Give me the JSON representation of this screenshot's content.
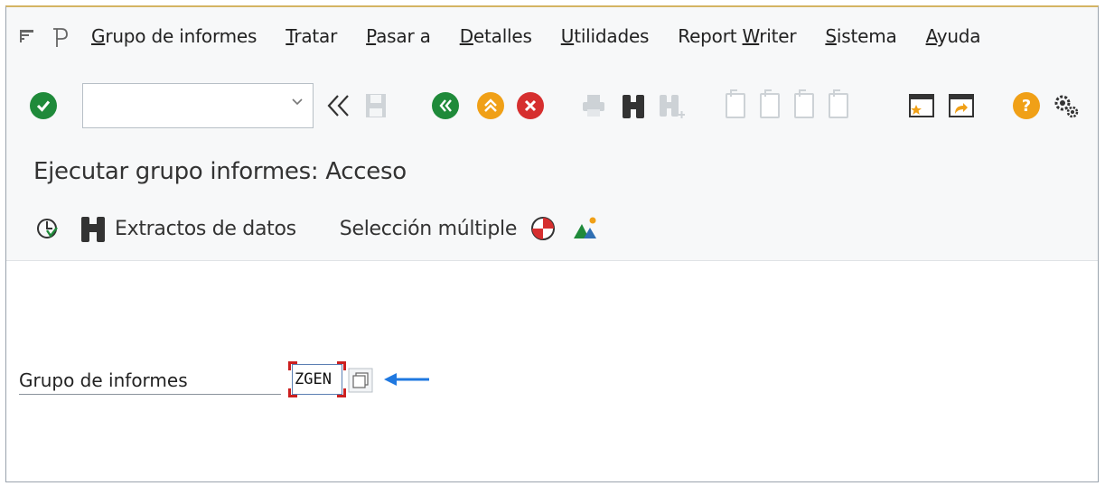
{
  "menu": {
    "items": [
      {
        "pre": "",
        "acc": "G",
        "post": "rupo de informes"
      },
      {
        "pre": "",
        "acc": "T",
        "post": "ratar"
      },
      {
        "pre": "",
        "acc": "P",
        "post": "asar a"
      },
      {
        "pre": "",
        "acc": "D",
        "post": "etalles"
      },
      {
        "pre": "",
        "acc": "U",
        "post": "tilidades"
      },
      {
        "pre": "Report ",
        "acc": "W",
        "post": "riter"
      },
      {
        "pre": "",
        "acc": "S",
        "post": "istema"
      },
      {
        "pre": "",
        "acc": "A",
        "post": "yuda"
      }
    ]
  },
  "toolbar": {
    "command_value": "",
    "icons": [
      "enter-icon",
      "command-dropdown-icon",
      "back-double-icon",
      "save-icon",
      "back-icon",
      "exit-icon",
      "cancel-icon",
      "print-icon",
      "find-icon",
      "find-next-icon",
      "first-page-icon",
      "previous-page-icon",
      "next-page-icon",
      "last-page-icon",
      "new-session-icon",
      "shortcut-icon",
      "help-icon",
      "settings-icon"
    ],
    "colors": {
      "green": "#1f8a3a",
      "orange": "#f0a017",
      "red": "#d62f2f"
    }
  },
  "title": {
    "text": "Ejecutar grupo informes: Acceso"
  },
  "app_toolbar": {
    "extracts_label": "Extractos de datos",
    "multi_select_label": "Selección múltiple"
  },
  "form": {
    "label": "Grupo de informes",
    "value": "ZGEN"
  }
}
